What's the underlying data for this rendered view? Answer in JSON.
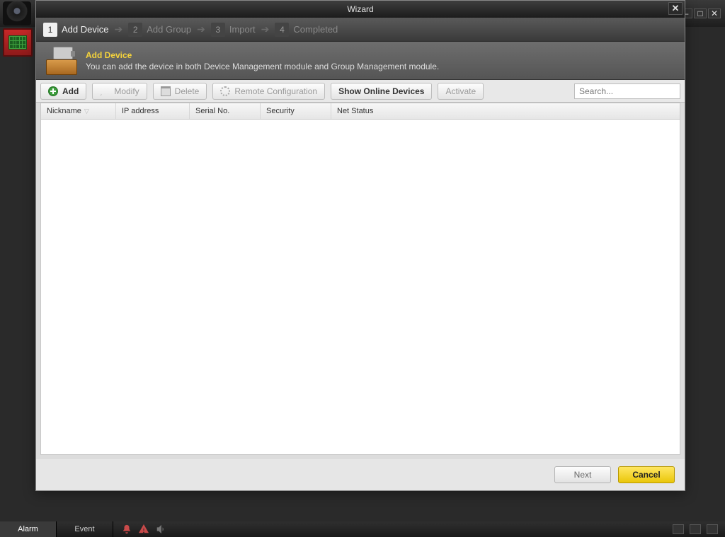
{
  "outer_window": {
    "tooltip_min": "Minimize",
    "tooltip_restore": "Restore",
    "tooltip_close": "Close"
  },
  "wizard": {
    "title": "Wizard",
    "steps": [
      {
        "num": "1",
        "label": "Add Device",
        "active": true
      },
      {
        "num": "2",
        "label": "Add Group",
        "active": false
      },
      {
        "num": "3",
        "label": "Import",
        "active": false
      },
      {
        "num": "4",
        "label": "Completed",
        "active": false
      }
    ],
    "banner": {
      "heading": "Add Device",
      "desc": "You can add the device in both Device Management module and Group Management module."
    },
    "toolbar": {
      "add": "Add",
      "modify": "Modify",
      "delete": "Delete",
      "remote_cfg": "Remote Configuration",
      "show_online": "Show Online Devices",
      "activate": "Activate",
      "search_placeholder": "Search..."
    },
    "grid": {
      "columns": [
        "Nickname",
        "IP address",
        "Serial No.",
        "Security",
        "Net Status"
      ],
      "rows": []
    },
    "footer": {
      "next": "Next",
      "cancel": "Cancel"
    }
  },
  "statusbar": {
    "tabs": [
      "Alarm",
      "Event"
    ]
  }
}
